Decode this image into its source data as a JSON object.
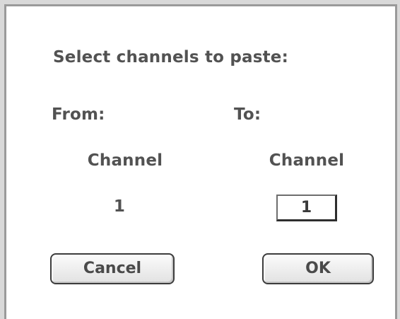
{
  "dialog": {
    "prompt": "Select channels to paste:",
    "from_label": "From:",
    "to_label": "To:",
    "from_channel_header": "Channel",
    "to_channel_header": "Channel",
    "from_channel_value": "1",
    "to_channel_value": "1",
    "cancel_label": "Cancel",
    "ok_label": "OK"
  }
}
